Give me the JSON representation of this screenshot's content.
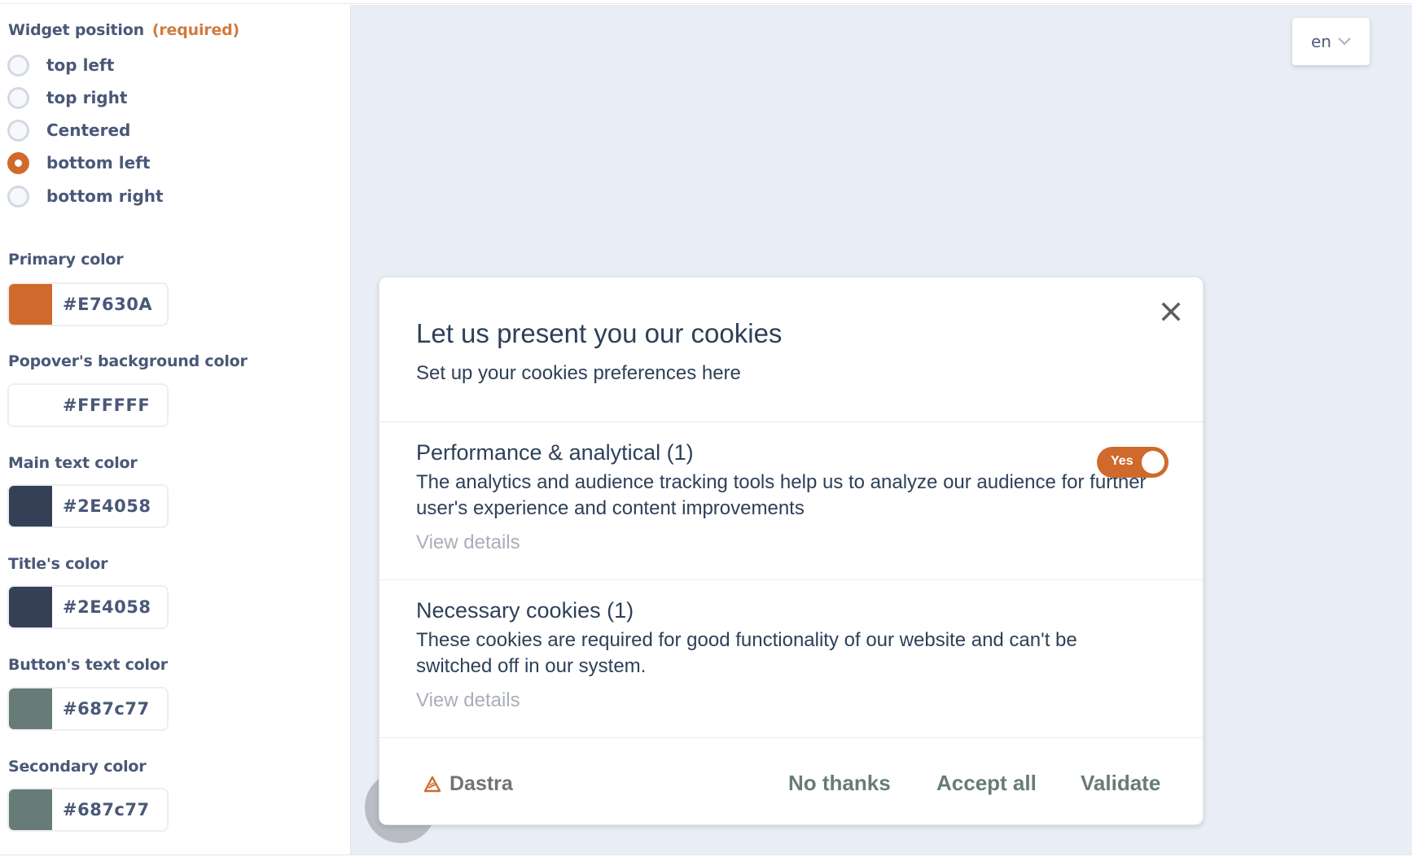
{
  "settings": {
    "widget_position": {
      "label": "Widget position",
      "required_label": "(required)",
      "options": [
        {
          "label": "top left",
          "checked": false
        },
        {
          "label": "top right",
          "checked": false
        },
        {
          "label": "Centered",
          "checked": false
        },
        {
          "label": "bottom left",
          "checked": true
        },
        {
          "label": "bottom right",
          "checked": false
        }
      ]
    },
    "colors": [
      {
        "label": "Primary color",
        "value": "#E7630A",
        "swatch": "#D06A2C"
      },
      {
        "label": "Popover's background color",
        "value": "#FFFFFF",
        "swatch": "#FFFFFF"
      },
      {
        "label": "Main text color",
        "value": "#2E4058",
        "swatch": "#353F55"
      },
      {
        "label": "Title's color",
        "value": "#2E4058",
        "swatch": "#353F55"
      },
      {
        "label": "Button's text color",
        "value": "#687c77",
        "swatch": "#687C77"
      },
      {
        "label": "Secondary color",
        "value": "#687c77",
        "swatch": "#687C77"
      }
    ]
  },
  "preview": {
    "language": {
      "selected": "en"
    },
    "modal": {
      "title": "Let us present you our cookies",
      "subtitle": "Set up your cookies preferences here",
      "sections": [
        {
          "title": "Performance & analytical (1)",
          "description": "The analytics and audience tracking tools help us to analyze our audience for further user's experience and content improvements",
          "view_details": "View details",
          "toggle": {
            "label": "Yes",
            "on": true
          }
        },
        {
          "title": "Necessary cookies (1)",
          "description": "These cookies are required for good functionality of our website and can't be switched off in our system.",
          "view_details": "View details"
        }
      ],
      "footer": {
        "brand": "Dastra",
        "buttons": {
          "no_thanks": "No thanks",
          "accept_all": "Accept all",
          "validate": "Validate"
        }
      }
    }
  },
  "theme": {
    "primary": "#D06A2C",
    "text": "#2E4058",
    "button_text": "#687C77"
  }
}
